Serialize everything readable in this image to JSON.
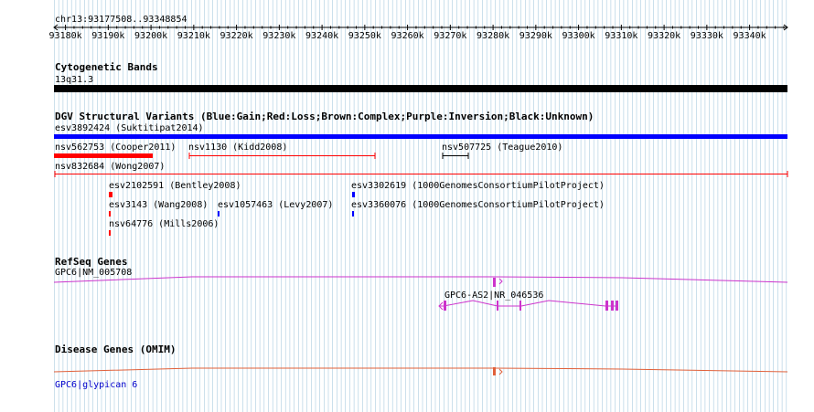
{
  "ruler": {
    "region": "chr13:93177508..93348854",
    "ticks": [
      "93180k",
      "93190k",
      "93200k",
      "93210k",
      "93220k",
      "93230k",
      "93240k",
      "93250k",
      "93260k",
      "93270k",
      "93280k",
      "93290k",
      "93300k",
      "93310k",
      "93320k",
      "93330k",
      "93340k"
    ]
  },
  "cytoband": {
    "title": "Cytogenetic Bands",
    "band": "13q31.3"
  },
  "dgv": {
    "title": "DGV Structural Variants (Blue:Gain;Red:Loss;Brown:Complex;Purple:Inversion;Black:Unknown)",
    "labels": {
      "esv3892424": "esv3892424 (Suktitipat2014)",
      "nsv562753": "nsv562753 (Cooper2011)",
      "nsv1130": "nsv1130 (Kidd2008)",
      "nsv507725": "nsv507725 (Teague2010)",
      "nsv832684": "nsv832684 (Wong2007)",
      "esv2102591": "esv2102591 (Bentley2008)",
      "esv3302619": "esv3302619 (1000GenomesConsortiumPilotProject)",
      "esv3143": "esv3143 (Wang2008)",
      "esv1057463": "esv1057463 (Levy2007)",
      "esv3360076": "esv3360076 (1000GenomesConsortiumPilotProject)",
      "nsv64776": "nsv64776 (Mills2006)"
    }
  },
  "refseq": {
    "title": "RefSeq Genes",
    "gene1": "GPC6|NM_005708",
    "gene2": "GPC6-AS2|NR_046536"
  },
  "omim": {
    "title": "Disease Genes (OMIM)",
    "gene": "GPC6|glypican 6"
  },
  "colors": {
    "grid": "#a9cbe0",
    "gain": "#0000ff",
    "loss": "#ff0000",
    "unknown": "#000000",
    "refseq": "#cc33cc",
    "omim": "#e0603a",
    "link": "#0000cc"
  }
}
